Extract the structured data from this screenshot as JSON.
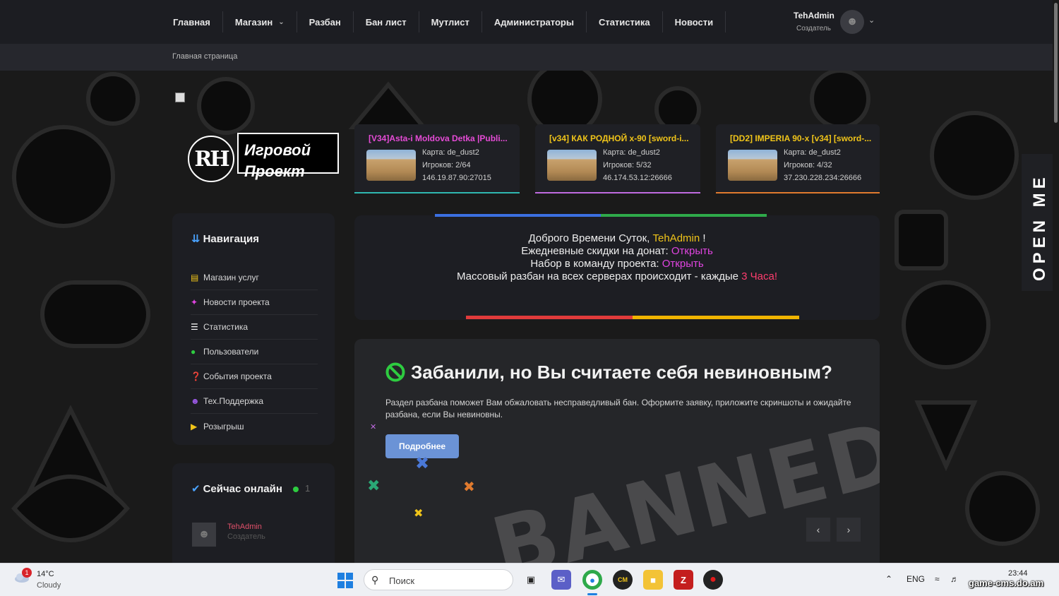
{
  "nav": {
    "items": [
      {
        "label": "Главная"
      },
      {
        "label": "Магазин",
        "dropdown": true
      },
      {
        "label": "Разбан"
      },
      {
        "label": "Бан лист"
      },
      {
        "label": "Мутлист"
      },
      {
        "label": "Администраторы"
      },
      {
        "label": "Статистика"
      },
      {
        "label": "Новости"
      }
    ],
    "user": {
      "name": "TehAdmin",
      "role": "Создатель"
    }
  },
  "breadcrumb": "Главная страница",
  "logo": {
    "initials": "RH",
    "line1": "Игровой",
    "line2": "Проект"
  },
  "servers": [
    {
      "title": "[V34]Asta-i Moldova Detka |Publi...",
      "map": "Карта: de_dust2",
      "players": "Игроков: 2/64",
      "address": "146.19.87.90:27015",
      "title_color": "#e54bd6",
      "accent": "#2fb8b0"
    },
    {
      "title": "[v34] КАК РОДНОЙ x-90 [sword-i...",
      "map": "Карта: de_dust2",
      "players": "Игроков: 5/32",
      "address": "46.174.53.12:26666",
      "title_color": "#f0c419",
      "accent": "#c06be0"
    },
    {
      "title": "[DD2] IMPERIA 90-x [v34] [sword-...",
      "map": "Карта: de_dust2",
      "players": "Игроков: 4/32",
      "address": "37.230.228.234:26666",
      "title_color": "#f0c419",
      "accent": "#e07a2e"
    }
  ],
  "sidebar": {
    "title": "Навигация",
    "items": [
      {
        "label": "Магазин услуг",
        "icon": "basket-icon",
        "color": "#f0c419"
      },
      {
        "label": "Новости проекта",
        "icon": "pin-icon",
        "color": "#e044e0"
      },
      {
        "label": "Статистика",
        "icon": "list-icon",
        "color": "#ffffff"
      },
      {
        "label": "Пользователи",
        "icon": "user-icon",
        "color": "#2ecc40"
      },
      {
        "label": "События проекта",
        "icon": "question-icon",
        "color": "#21c5c5"
      },
      {
        "label": "Тех.Поддержка",
        "icon": "users-icon",
        "color": "#9b59e6"
      },
      {
        "label": "Розыгрыш",
        "icon": "megaphone-icon",
        "color": "#f0c419"
      }
    ]
  },
  "online": {
    "title": "Сейчас онлайн",
    "count": "1",
    "users": [
      {
        "name": "TehAdmin",
        "role": "Создатель"
      }
    ]
  },
  "welcome": {
    "line1_prefix": "Доброго Времени Суток, ",
    "line1_name": "TehAdmin",
    "line1_suffix": " !",
    "line2_prefix": "Ежедневные скидки на донат: ",
    "line2_link": "Открыть",
    "line3_prefix": "Набор в команду проекта: ",
    "line3_link": "Открыть",
    "line4_prefix": "Массовый разбан на всех серверах происходит - каждые ",
    "line4_highlight": "3 Часа!"
  },
  "unban": {
    "title": "Забанили, но Вы считаете себя невиновным?",
    "description": "Раздел разбана поможет Вам обжаловать несправедливый бан. Оформите заявку, приложите скриншоты и ожидайте разбана, если Вы невиновны.",
    "button": "Подробнее",
    "stamp": "BANNED",
    "prev": "‹",
    "next": "›"
  },
  "open_me": "OPEN ME",
  "taskbar": {
    "weather_temp": "14°C",
    "weather_desc": "Cloudy",
    "weather_badge": "1",
    "search_placeholder": "Поиск",
    "lang": "ENG",
    "time": "23:44",
    "watermark": "game-cms.do.am"
  }
}
